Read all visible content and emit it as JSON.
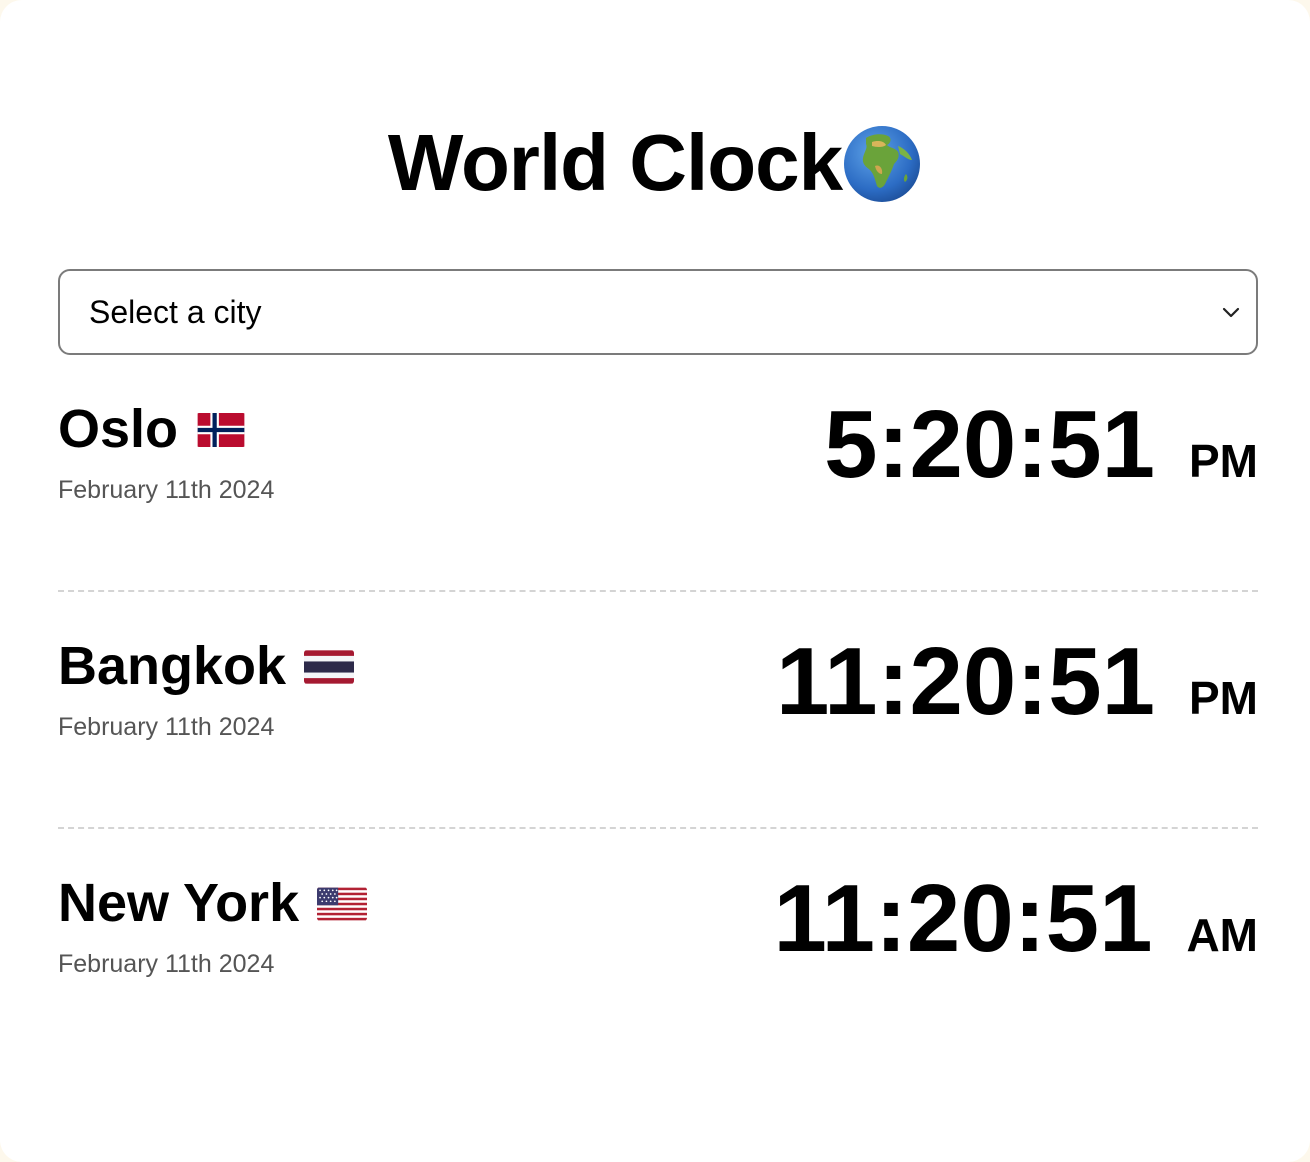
{
  "app": {
    "title": "World Clock"
  },
  "icons": {
    "title_icon": "globe-africa-icon",
    "select_icon": "chevron-down-icon"
  },
  "city_select": {
    "selected_label": "Select a city"
  },
  "cities": [
    {
      "name": "Oslo",
      "flag": "norway-flag-icon",
      "date": "February 11th 2024",
      "time": "5:20:51",
      "ampm": "PM"
    },
    {
      "name": "Bangkok",
      "flag": "thailand-flag-icon",
      "date": "February 11th 2024",
      "time": "11:20:51",
      "ampm": "PM"
    },
    {
      "name": "New York",
      "flag": "usa-flag-icon",
      "date": "February 11th 2024",
      "time": "11:20:51",
      "ampm": "AM"
    }
  ]
}
